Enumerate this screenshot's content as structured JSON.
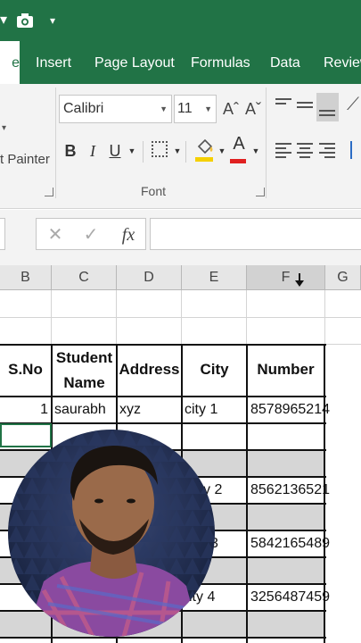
{
  "quick_access": {
    "caret": "▾",
    "camera_icon": "camera-icon",
    "more": "▾"
  },
  "tabs": [
    {
      "label": "e",
      "active": true
    },
    {
      "label": "Insert"
    },
    {
      "label": "Page Layout"
    },
    {
      "label": "Formulas"
    },
    {
      "label": "Data"
    },
    {
      "label": "Review"
    }
  ],
  "ribbon": {
    "clipboard": {
      "format_painter": "t Painter"
    },
    "font": {
      "group_label": "Font",
      "font_name": "Calibri",
      "font_size": "11",
      "grow": "Aˆ",
      "shrink": "Aˇ",
      "bold": "B",
      "italic": "I",
      "underline": "U",
      "font_color": "A",
      "font_color_hex": "#e02020"
    }
  },
  "formula_bar": {
    "cancel": "✕",
    "enter": "✓",
    "fx": "fx",
    "value": ""
  },
  "columns": [
    "B",
    "C",
    "D",
    "E",
    "F",
    "G"
  ],
  "table": {
    "headers": {
      "sno": "S.No",
      "student_name_1": "Student",
      "student_name_2": "Name",
      "address": "Address",
      "city": "City",
      "number": "Number"
    },
    "rows": [
      {
        "sno": "1",
        "name": "saurabh",
        "address": "xyz",
        "city": "city 1",
        "number": "8578965214"
      },
      {
        "sno": "",
        "name": "",
        "address": "",
        "city": "y 2",
        "number": "8562136521"
      },
      {
        "sno": "",
        "name": "",
        "address": "",
        "city": "3",
        "number": "5842165489"
      },
      {
        "sno": "",
        "name": "",
        "address": "",
        "city": "ity 4",
        "number": "3256487459"
      }
    ]
  },
  "colors": {
    "accent": "#217346",
    "row_shade": "#d6d6d6"
  }
}
